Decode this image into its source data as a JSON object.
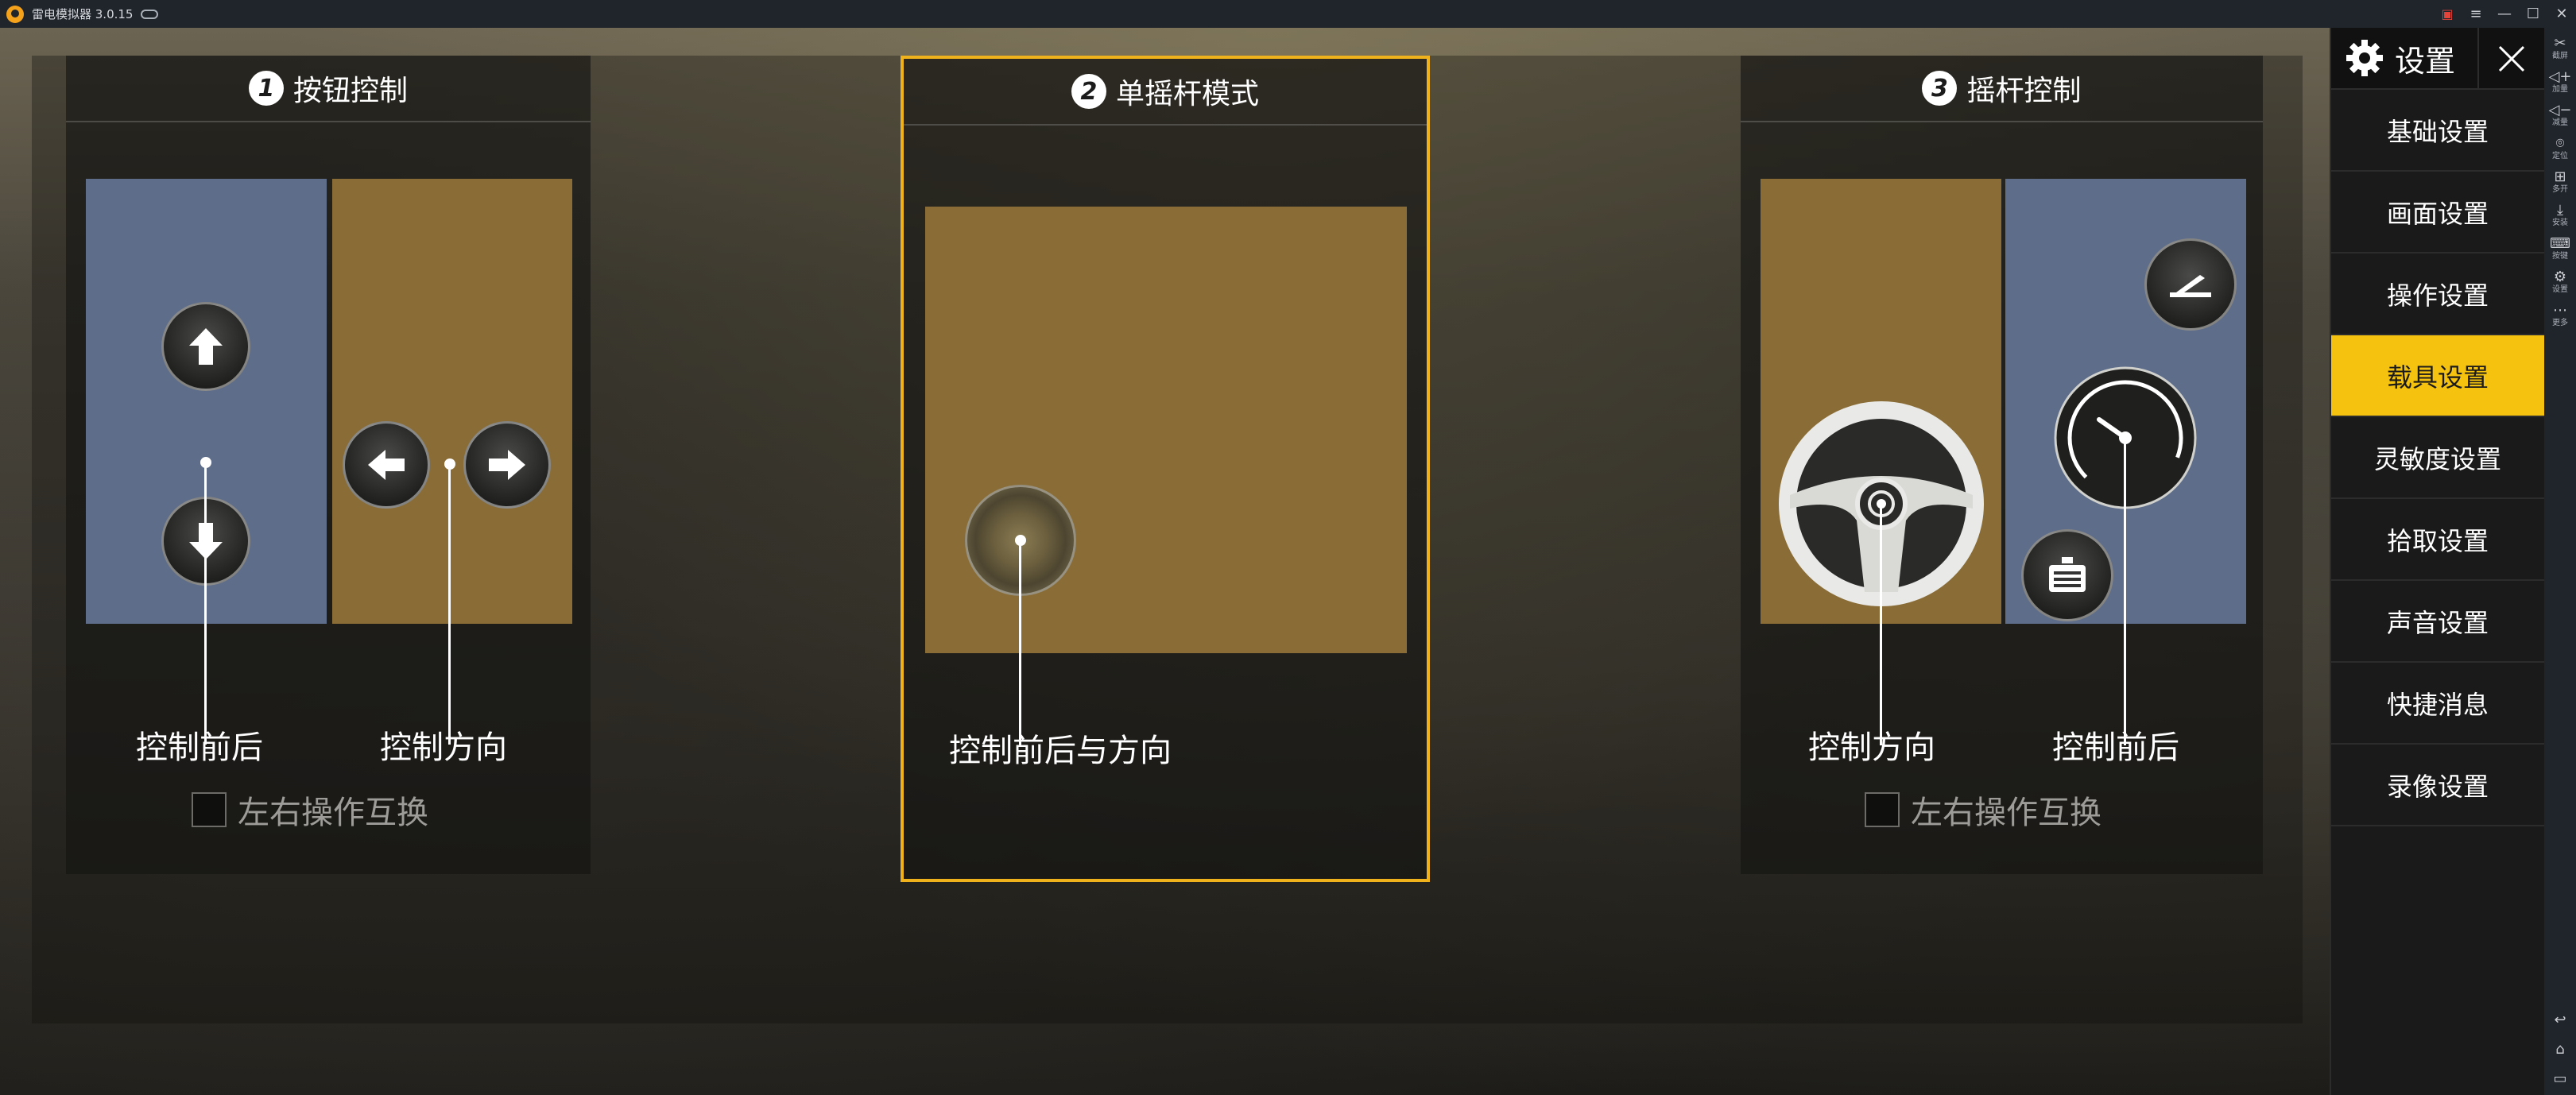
{
  "emulator": {
    "title": "雷电模拟器 3.0.15",
    "window_controls": [
      "—",
      "☐",
      "✕"
    ],
    "toolbar": [
      {
        "icon": "screenshot-icon",
        "label": "截屏"
      },
      {
        "icon": "volume-up-icon",
        "label": "加量"
      },
      {
        "icon": "volume-down-icon",
        "label": "减量"
      },
      {
        "icon": "location-icon",
        "label": "定位"
      },
      {
        "icon": "multi-open-icon",
        "label": "多开"
      },
      {
        "icon": "apk-install-icon",
        "label": "安装"
      },
      {
        "icon": "keyboard-icon",
        "label": "按键"
      },
      {
        "icon": "settings-icon",
        "label": "设置"
      },
      {
        "icon": "more-icon",
        "label": "更多"
      }
    ]
  },
  "modes": [
    {
      "number": "1",
      "title": "按钮控制",
      "captions": [
        "控制前后",
        "控制方向"
      ],
      "swap_label": "左右操作互换"
    },
    {
      "number": "2",
      "title": "单摇杆模式",
      "captions": [
        "控制前后与方向"
      ]
    },
    {
      "number": "3",
      "title": "摇杆控制",
      "captions": [
        "控制方向",
        "控制前后"
      ],
      "swap_label": "左右操作互换"
    }
  ],
  "settings": {
    "title": "设置",
    "menu": [
      "基础设置",
      "画面设置",
      "操作设置",
      "载具设置",
      "灵敏度设置",
      "拾取设置",
      "声音设置",
      "快捷消息",
      "录像设置"
    ],
    "active": "载具设置"
  },
  "colors": {
    "accent": "#f0b21c",
    "active_menu": "#f5c30f",
    "blue_zone": "#5e6d89",
    "gold_zone": "#8a6d36"
  }
}
